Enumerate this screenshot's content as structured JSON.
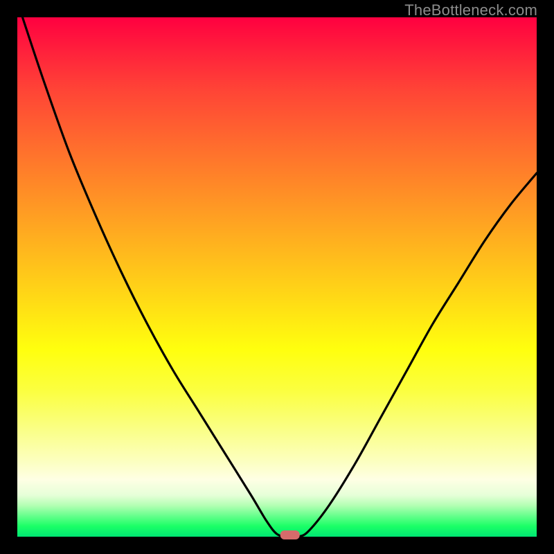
{
  "watermark": "TheBottleneck.com",
  "chart_data": {
    "type": "line",
    "title": "",
    "xlabel": "",
    "ylabel": "",
    "xlim": [
      0,
      100
    ],
    "ylim": [
      0,
      100
    ],
    "description": "Bottleneck curve on a green-to-red heat gradient. The black curve descends steeply from top-left, reaches a minimum near x≈52 at y≈0, and rises again toward the right edge to about y≈70. A small red rounded marker sits at the curve minimum.",
    "series": [
      {
        "name": "bottleneck-curve",
        "x": [
          1,
          5,
          10,
          15,
          20,
          25,
          30,
          35,
          40,
          45,
          48,
          50,
          52,
          54,
          56,
          60,
          65,
          70,
          75,
          80,
          85,
          90,
          95,
          100
        ],
        "y": [
          100,
          88,
          74,
          62,
          51,
          41,
          32,
          24,
          16,
          8,
          3,
          0.5,
          0,
          0,
          1,
          6,
          14,
          23,
          32,
          41,
          49,
          57,
          64,
          70
        ]
      }
    ],
    "marker": {
      "x": 52.5,
      "y": 0,
      "color": "#d66b6b"
    },
    "gradient_stops": [
      {
        "pos": 0.0,
        "color": "#ff0040"
      },
      {
        "pos": 0.5,
        "color": "#ffd916"
      },
      {
        "pos": 0.85,
        "color": "#ffffcc"
      },
      {
        "pos": 1.0,
        "color": "#00e673"
      }
    ]
  }
}
